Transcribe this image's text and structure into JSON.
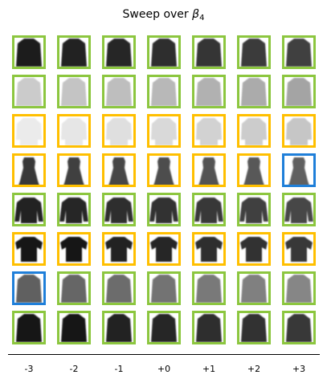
{
  "title_prefix": "Sweep over ",
  "title_symbol": "β",
  "title_subscript": "4",
  "x_tick_labels": [
    "-3",
    "-2",
    "-1",
    "+0",
    "+1",
    "+2",
    "+3"
  ],
  "colors": {
    "green": "#8cc63f",
    "orange": "#ffbf00",
    "blue": "#1f7fd9"
  },
  "rows": [
    {
      "garment": "coat",
      "shade": 0.18,
      "borders": [
        "green",
        "green",
        "green",
        "green",
        "green",
        "green",
        "green"
      ]
    },
    {
      "garment": "light-coat",
      "shade": 0.72,
      "borders": [
        "green",
        "green",
        "green",
        "green",
        "green",
        "green",
        "green"
      ]
    },
    {
      "garment": "shirt",
      "shade": 0.85,
      "borders": [
        "orange",
        "orange",
        "orange",
        "orange",
        "orange",
        "orange",
        "orange"
      ]
    },
    {
      "garment": "dress",
      "shade": 0.3,
      "borders": [
        "orange",
        "orange",
        "orange",
        "orange",
        "orange",
        "orange",
        "blue"
      ]
    },
    {
      "garment": "pullover",
      "shade": 0.2,
      "borders": [
        "green",
        "green",
        "green",
        "green",
        "green",
        "green",
        "green"
      ]
    },
    {
      "garment": "tshirt",
      "shade": 0.15,
      "borders": [
        "orange",
        "orange",
        "orange",
        "orange",
        "orange",
        "orange",
        "orange"
      ]
    },
    {
      "garment": "coat",
      "shade": 0.45,
      "borders": [
        "blue",
        "green",
        "green",
        "green",
        "green",
        "green",
        "green"
      ]
    },
    {
      "garment": "coat",
      "shade": 0.15,
      "borders": [
        "green",
        "green",
        "green",
        "green",
        "green",
        "green",
        "green"
      ]
    }
  ]
}
